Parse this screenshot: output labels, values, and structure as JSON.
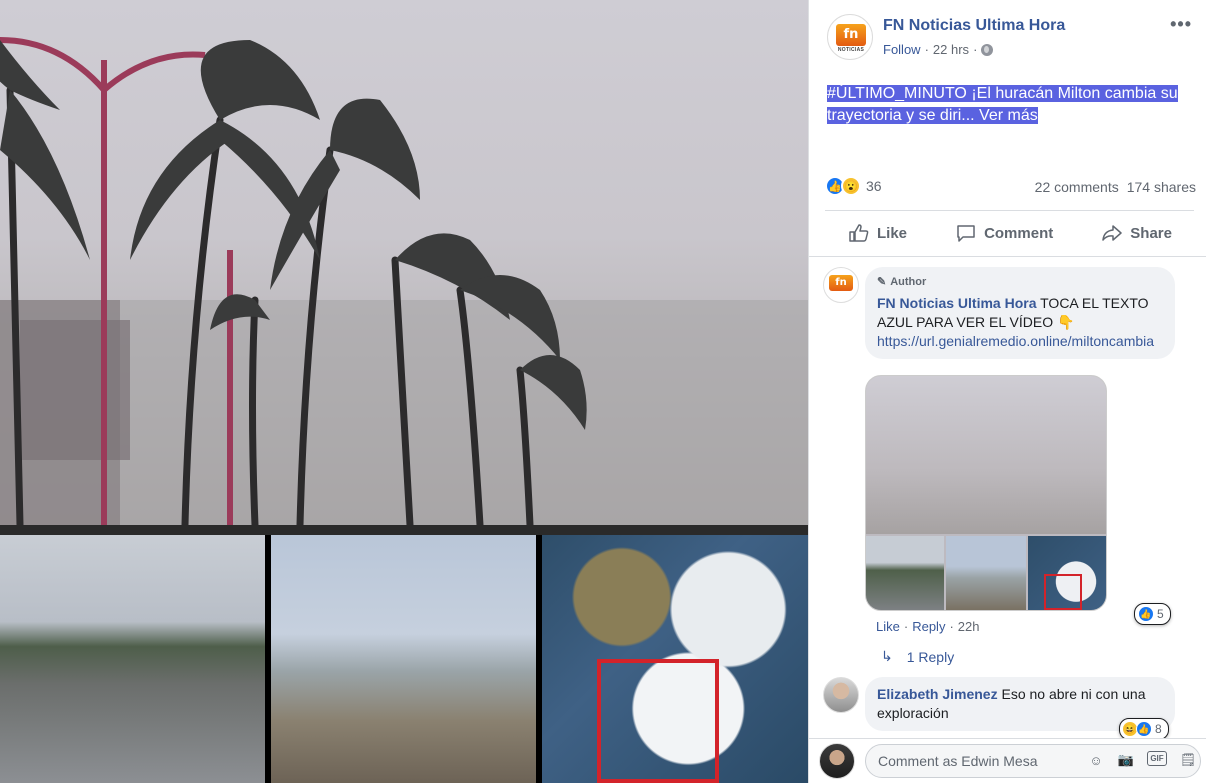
{
  "post": {
    "page_name": "FN Noticias Ultima Hora",
    "logo_letters": "fn",
    "logo_caption": "NOTICIAS",
    "follow_label": "Follow",
    "separator": "·",
    "time": "22 hrs",
    "text_line1": "#ÚLTIMO_MINUTO ¡El huracán Milton cambia su",
    "text_line2": "trayectoria y se diri... Ver más",
    "reaction_count": "36",
    "comments_count": "22 comments",
    "shares_count": "174 shares",
    "actions": {
      "like": "Like",
      "comment": "Comment",
      "share": "Share"
    },
    "more_glyph": "•••"
  },
  "comments": [
    {
      "badge": "Author",
      "author": "FN Noticias Ultima Hora",
      "text": "TOCA EL TEXTO AZUL PARA VER EL VÍDEO 👇",
      "link": "https://url.genialremedio.online/miltoncambia",
      "reaction_count": "5",
      "like_label": "Like",
      "reply_label": "Reply",
      "time": "22h",
      "replies_label": "1 Reply"
    },
    {
      "author": "Elizabeth Jimenez",
      "text": "Eso no abre ni con una exploración",
      "reaction_count": "8"
    }
  ],
  "composer": {
    "placeholder": "Comment as Edwin Mesa",
    "gif_label": "GIF"
  },
  "colors": {
    "link_blue": "#385898",
    "highlight": "#5a62e0",
    "like_blue": "#1877f2"
  }
}
